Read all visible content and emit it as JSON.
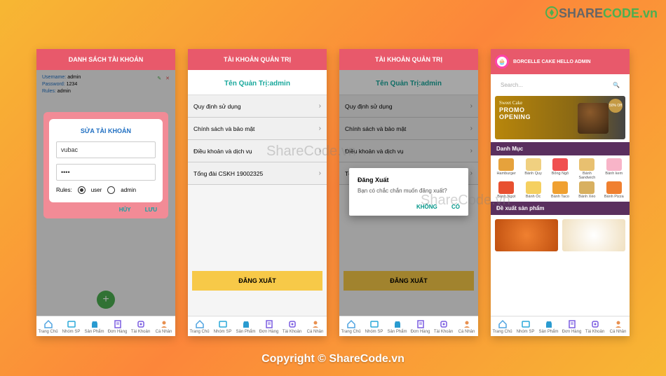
{
  "brand_logo": {
    "name_1": "SHARE",
    "name_2": "CODE",
    "suffix": ".vn"
  },
  "watermark_text": "ShareCode.vn",
  "copyright": "Copyright © ShareCode.vn",
  "bottom_nav": [
    {
      "label": "Trang Chủ"
    },
    {
      "label": "Nhóm SP"
    },
    {
      "label": "Sản Phẩm"
    },
    {
      "label": "Đơn Hàng"
    },
    {
      "label": "Tài Khoản"
    },
    {
      "label": "Cá Nhân"
    }
  ],
  "phone1": {
    "title": "DANH SÁCH TÀI KHOẢN",
    "info": {
      "username_label": "Username:",
      "username": "admin",
      "password_label": "Password:",
      "password": "1234",
      "rules_label": "Rules:",
      "rules": "admin"
    },
    "modal": {
      "title": "SỬA TÀI KHOẢN",
      "username": "vubac",
      "password": "••••",
      "rules_label": "Rules:",
      "opt_user": "user",
      "opt_admin": "admin",
      "cancel": "HỦY",
      "save": "LƯU"
    }
  },
  "phone2": {
    "title": "TÀI KHOẢN QUẢN TRỊ",
    "subhead": "Tên Quản Trị:admin",
    "items": [
      "Quy định sử dụng",
      "Chính sách và bảo mật",
      "Điều khoản và dịch vụ",
      "Tổng đài CSKH 19002325"
    ],
    "logout": "ĐĂNG XUẤT"
  },
  "phone3": {
    "title": "TÀI KHOẢN QUẢN TRỊ",
    "subhead": "Tên Quản Trị:admin",
    "items": [
      "Quy định sử dụng",
      "Chính sách và bảo mật",
      "Điều khoản và dịch vụ",
      "Tổng đài CSKH 19002325"
    ],
    "logout": "ĐĂNG XUẤT",
    "dialog": {
      "title": "Đăng Xuất",
      "message": "Bạn có chắc chắn muốn đăng xuất?",
      "no": "KHÔNG",
      "yes": "CÓ"
    }
  },
  "phone4": {
    "title": "BORCELLE CAKE HELLO ADMIN",
    "search_placeholder": "Search...",
    "banner": {
      "tag": "Sweet Cake",
      "line1": "PROMO",
      "line2": "OPENING",
      "off": "50% Off"
    },
    "sec1": "Danh Mục",
    "categories": [
      {
        "label": "Hamburger",
        "color": "#e6a23c"
      },
      {
        "label": "Bánh Quy",
        "color": "#f0d080"
      },
      {
        "label": "Bỏng Ngô",
        "color": "#f05050"
      },
      {
        "label": "Bánh Sandwich",
        "color": "#e8c070"
      },
      {
        "label": "Bánh kem",
        "color": "#f8b4c8"
      },
      {
        "label": "Bánh Ngọt",
        "color": "#e85030"
      },
      {
        "label": "Bánh Óc",
        "color": "#f5d060"
      },
      {
        "label": "Bánh Taco",
        "color": "#f0a030"
      },
      {
        "label": "Bánh Xèo",
        "color": "#d8b060"
      },
      {
        "label": "Bánh Pizza",
        "color": "#f08030"
      }
    ],
    "sec2": "Đề xuất sản phẩm"
  }
}
